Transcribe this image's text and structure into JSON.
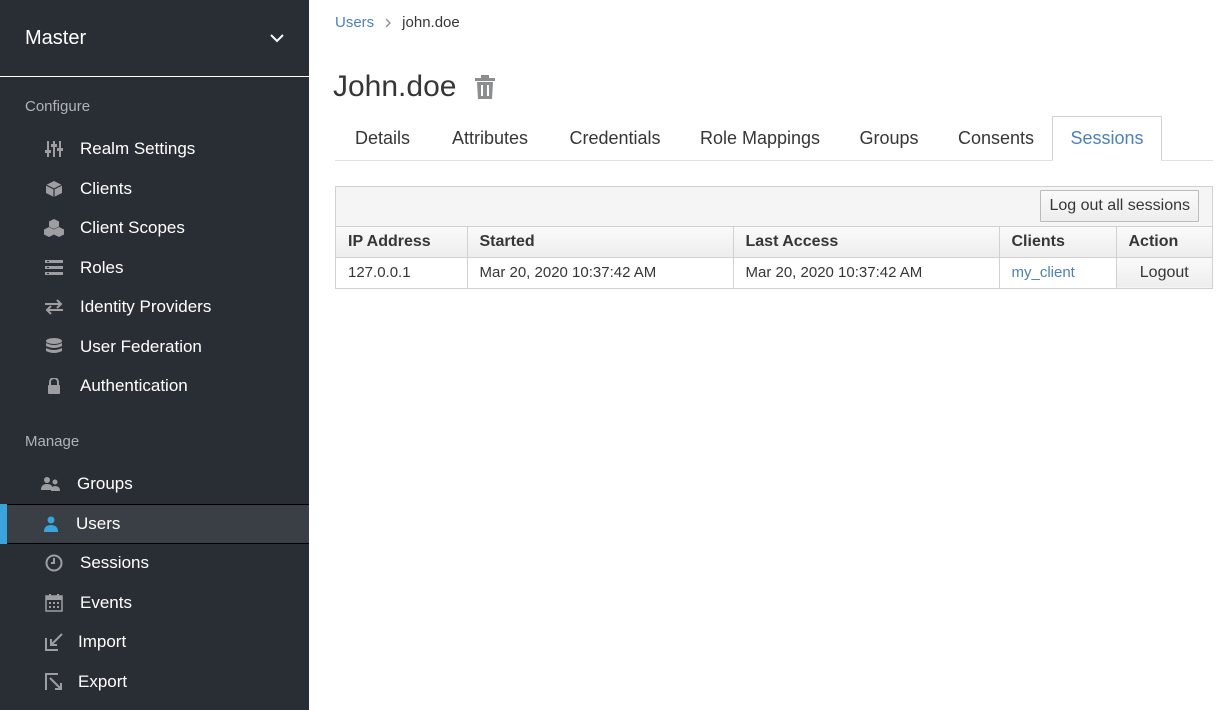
{
  "sidebar": {
    "realm": "Master",
    "configure_title": "Configure",
    "manage_title": "Manage",
    "configure_items": [
      {
        "label": "Realm Settings",
        "icon": "sliders-icon"
      },
      {
        "label": "Clients",
        "icon": "cube-icon"
      },
      {
        "label": "Client Scopes",
        "icon": "cubes-icon"
      },
      {
        "label": "Roles",
        "icon": "list-icon"
      },
      {
        "label": "Identity Providers",
        "icon": "exchange-icon"
      },
      {
        "label": "User Federation",
        "icon": "database-icon"
      },
      {
        "label": "Authentication",
        "icon": "lock-icon"
      }
    ],
    "manage_items": [
      {
        "label": "Groups",
        "icon": "users-icon"
      },
      {
        "label": "Users",
        "icon": "user-icon",
        "active": true
      },
      {
        "label": "Sessions",
        "icon": "clock-icon"
      },
      {
        "label": "Events",
        "icon": "calendar-icon"
      },
      {
        "label": "Import",
        "icon": "import-icon"
      },
      {
        "label": "Export",
        "icon": "export-icon"
      }
    ]
  },
  "breadcrumb": {
    "parent": "Users",
    "current": "john.doe"
  },
  "page_title": "John.doe",
  "tabs": [
    "Details",
    "Attributes",
    "Credentials",
    "Role Mappings",
    "Groups",
    "Consents",
    "Sessions"
  ],
  "active_tab": "Sessions",
  "toolbar": {
    "logout_all": "Log out all sessions"
  },
  "table": {
    "headers": [
      "IP Address",
      "Started",
      "Last Access",
      "Clients",
      "Action"
    ],
    "rows": [
      {
        "ip": "127.0.0.1",
        "started": "Mar 20, 2020 10:37:42 AM",
        "last_access": "Mar 20, 2020 10:37:42 AM",
        "client": "my_client",
        "action": "Logout"
      }
    ]
  },
  "colors": {
    "sidebar_bg": "#292e34",
    "accent": "#39a5dc",
    "link": "#4d81b8"
  }
}
